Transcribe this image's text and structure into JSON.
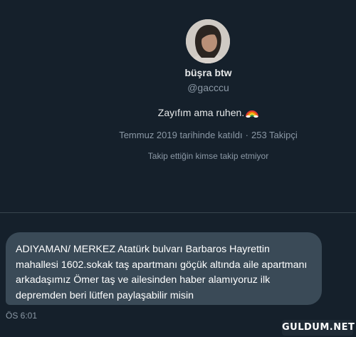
{
  "profile": {
    "name": "büşra btw",
    "handle": "@gacccu",
    "bio": "Zayıfım ama ruhen.",
    "bio_emoji": "rainbow-icon",
    "joined": "Temmuz 2019 tarihinde katıldı",
    "separator": "·",
    "followers": "253 Takipçi",
    "mutual_follow": "Takip ettiğin kimse takip etmiyor"
  },
  "message": {
    "text": "ADIYAMAN/ MERKEZ Atatürk bulvarı Barbaros Hayrettin mahallesi 1602.sokak taş apartmanı göçük altında aile apartmanı arkadaşımız Ömer taş ve ailesinden haber alamıyoruz ilk depremden beri lütfen paylaşabilir misin",
    "time": "ÖS 6:01"
  },
  "watermark": "GULDUM.NET",
  "colors": {
    "background": "#15202b",
    "bubble": "#3a4a57",
    "secondary_text": "#8b98a5"
  }
}
